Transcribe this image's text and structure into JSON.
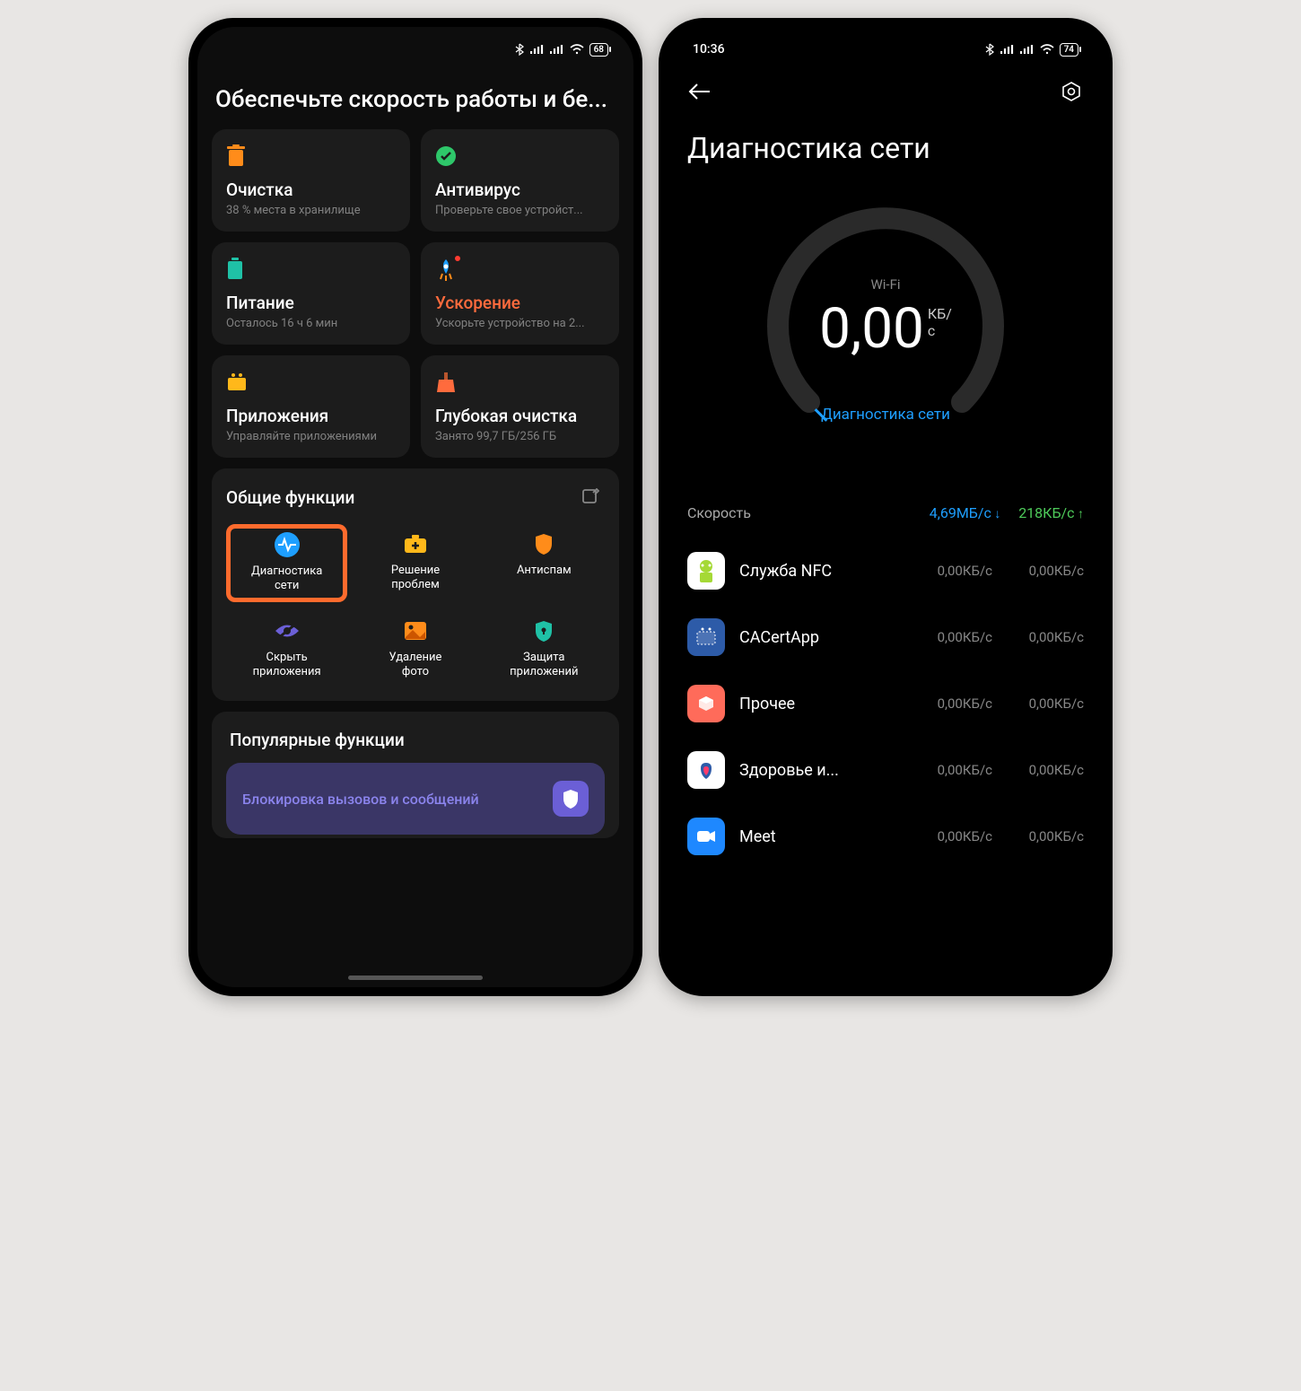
{
  "left": {
    "status": {
      "battery": "68"
    },
    "title": "Обеспечьте скорость работы и бе...",
    "cards": [
      {
        "title": "Очистка",
        "sub": "38 % места в хранилище"
      },
      {
        "title": "Антивирус",
        "sub": "Проверьте свое устройст..."
      },
      {
        "title": "Питание",
        "sub": "Осталось 16 ч 6 мин"
      },
      {
        "title": "Ускорение",
        "sub": "Ускорьте устройство на 2..."
      },
      {
        "title": "Приложения",
        "sub": "Управляйте приложениями"
      },
      {
        "title": "Глубокая очистка",
        "sub": "Занято 99,7 ГБ/256 ГБ"
      }
    ],
    "common_title": "Общие функции",
    "funcs": [
      {
        "label": "Диагностика\nсети"
      },
      {
        "label": "Решение\nпроблем"
      },
      {
        "label": "Антиспам"
      },
      {
        "label": "Скрыть\nприложения"
      },
      {
        "label": "Удаление\nфото"
      },
      {
        "label": "Защита\nприложений"
      }
    ],
    "popular_title": "Популярные функции",
    "popular_label": "Блокировка вызовов и сообщений"
  },
  "right": {
    "status": {
      "time": "10:36",
      "battery": "74"
    },
    "title": "Диагностика сети",
    "gauge_top": "Wi-Fi",
    "gauge_value": "0,00",
    "gauge_unit": "КБ/с",
    "gauge_link": "Диагностика сети",
    "speed_label": "Скорость",
    "speed_down": "4,69МБ/с",
    "speed_up": "218КБ/с",
    "apps": [
      {
        "name": "Служба NFC",
        "down": "0,00КБ/с",
        "up": "0,00КБ/с"
      },
      {
        "name": "CACertApp",
        "down": "0,00КБ/с",
        "up": "0,00КБ/с"
      },
      {
        "name": "Прочее",
        "down": "0,00КБ/с",
        "up": "0,00КБ/с"
      },
      {
        "name": "Здоровье и...",
        "down": "0,00КБ/с",
        "up": "0,00КБ/с"
      },
      {
        "name": "Meet",
        "down": "0,00КБ/с",
        "up": "0,00КБ/с"
      }
    ]
  }
}
